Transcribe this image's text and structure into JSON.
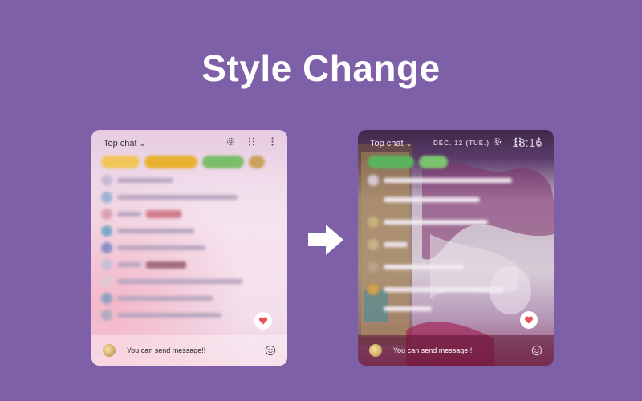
{
  "page": {
    "title": "Style Change",
    "background": "#7e60a8"
  },
  "before_panel": {
    "header_label": "Top chat",
    "input_placeholder": "You can send message!!",
    "icons": [
      "gear-icon",
      "grid-icon",
      "more-vertical-icon",
      "heart-icon",
      "emoji-icon",
      "chevron-down-icon"
    ]
  },
  "after_panel": {
    "header_label": "Top chat",
    "date": "DEC. 12 (TUE.)",
    "time": "18:16",
    "input_placeholder": "You can send message!!",
    "icons": [
      "gear-icon",
      "grid-icon",
      "more-vertical-icon",
      "heart-icon",
      "emoji-icon",
      "chevron-down-icon"
    ]
  },
  "colors": {
    "heart": "#e8505b",
    "arrow": "#ffffff"
  }
}
